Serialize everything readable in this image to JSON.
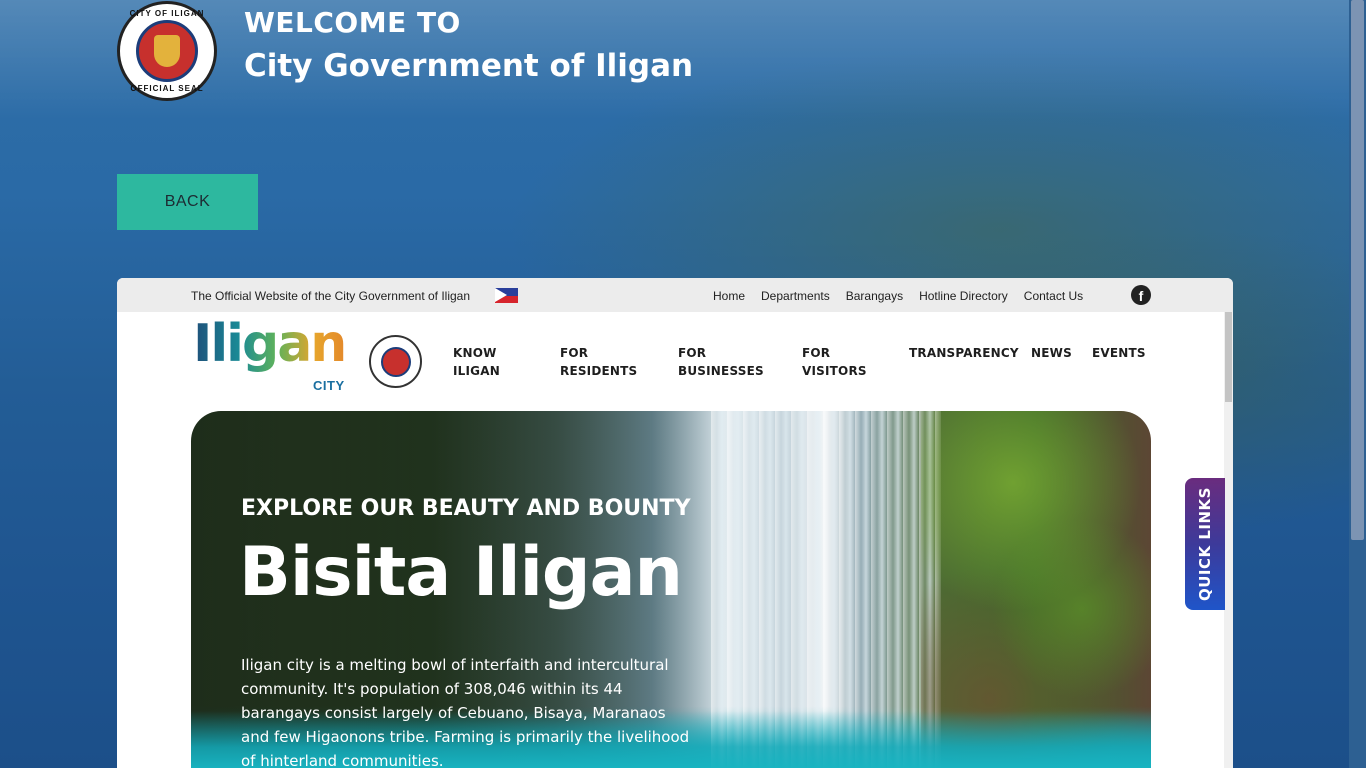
{
  "header": {
    "seal_top_text": "CITY OF ILIGAN",
    "seal_bottom_text": "OFFICIAL SEAL",
    "welcome": "WELCOME TO",
    "title": "City Government of Iligan",
    "back_label": "BACK"
  },
  "site": {
    "topbar": {
      "official_text": "The Official Website of the City Government of Iligan",
      "links": [
        "Home",
        "Departments",
        "Barangays",
        "Hotline Directory",
        "Contact Us"
      ],
      "facebook_glyph": "f"
    },
    "logo": {
      "word": "Iligan",
      "city": "CITY"
    },
    "nav": {
      "know_1": "KNOW",
      "know_2": "ILIGAN",
      "res_1": "FOR",
      "res_2": "RESIDENTS",
      "bus_1": "FOR",
      "bus_2": "BUSINESSES",
      "vis_1": "FOR",
      "vis_2": "VISITORS",
      "transparency": "TRANSPARENCY",
      "news": "NEWS",
      "events": "EVENTS"
    },
    "hero": {
      "kicker": "EXPLORE OUR BEAUTY AND BOUNTY",
      "title": "Bisita Iligan",
      "body": "Iligan city is a melting bowl of interfaith and intercultural community. It's population of 308,046 within its 44 barangays consist largely of Cebuano, Bisaya, Maranaos and few Higaonons tribe. Farming is primarily the livelihood of hinterland communities."
    },
    "quick_links": "QUICK LINKS"
  },
  "colors": {
    "back_button": "#2db89f",
    "quick_links_top": "#6a2c7e",
    "quick_links_bottom": "#1f55c9",
    "background": "#235d96"
  },
  "icons": {
    "flag": "philippine-flag-icon",
    "facebook": "facebook-icon",
    "seal": "city-seal"
  }
}
